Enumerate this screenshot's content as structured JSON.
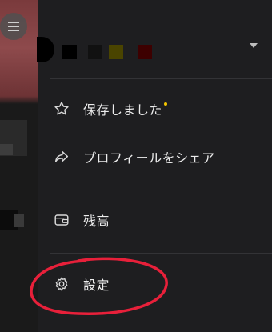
{
  "drawer": {
    "account": {
      "swatch_colors": [
        "#000000",
        "#111111",
        "#4a4400",
        "#3d0000"
      ]
    },
    "items": [
      {
        "label": "保存しました",
        "icon": "star-icon",
        "has_dot": true
      },
      {
        "label": "プロフィールをシェア",
        "icon": "share-icon"
      },
      {
        "label": "残高",
        "icon": "wallet-icon"
      },
      {
        "label": "設定",
        "icon": "gear-icon"
      }
    ]
  },
  "colors": {
    "background": "#1e1e20",
    "badge_dot": "#f2c500",
    "annotation": "#e8203a"
  }
}
